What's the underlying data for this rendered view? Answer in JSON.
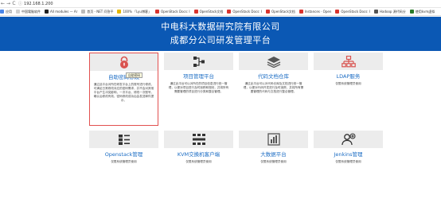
{
  "browser": {
    "url": "192.168.1.200",
    "nav": {
      "back": "←",
      "forward": "→",
      "reload": "C"
    },
    "bookmarks": [
      {
        "label": "应用",
        "color": "#4a86e8"
      },
      {
        "label": "中国電脑软件",
        "color": "#d0d0d0"
      },
      {
        "label": "All modules — Ar",
        "color": "#222222"
      },
      {
        "label": "首页 - NET 问答平",
        "color": "#bbbbbb"
      },
      {
        "label": "100% 「Lyu博客」",
        "color": "#e5b700"
      },
      {
        "label": "OpenStack Docs: I",
        "color": "#d9352f"
      },
      {
        "label": "OpenStack文档",
        "color": "#d9352f"
      },
      {
        "label": "OpenStack Docs: I",
        "color": "#d9352f"
      },
      {
        "label": "OpenStack文档",
        "color": "#d9352f"
      },
      {
        "label": "Instances · Open",
        "color": "#d9352f"
      },
      {
        "label": "OpenStack Docs: I",
        "color": "#d9352f"
      },
      {
        "label": "Hadoop 源代码分",
        "color": "#555555"
      },
      {
        "label": "使用kvm虚拟",
        "color": "#2a7a2a"
      }
    ]
  },
  "header": {
    "title_line1": "中电科大数据研究院有限公司",
    "title_line2": "成都分公司研发管理平台"
  },
  "cards": [
    {
      "title": "自助密码修改",
      "icon": "lock-icon",
      "icon_color": "#d9534f",
      "desc": "通过此平台对所在研发平台上的账号进行修改，可满足日常修改对应的密码需求，并不会对其他平台产生冲突影响，一次平台，修改一次账号，确认后修改有效，密码修改成功后会发送邮件提示。",
      "selected": true,
      "tooltip": "自助密码"
    },
    {
      "title": "项目管理平台",
      "icon": "sitemap-icon",
      "icon_color": "#333333",
      "desc": "通过此平台可以对所在的项目信息进行统一管理，以便对项目进行及时追踪和规划，并将所有需要管理的项目进行分类和整合管理。"
    },
    {
      "title": "代码文档仓库",
      "icon": "layers-icon",
      "icon_color": "#555555",
      "desc": "通过此平台可以对代码仓库及文档进行统一管理，以便对代码开发进行及时追踪，并将所有需要管理的代码与文档进行整合管理。"
    },
    {
      "title": "LDAP服务",
      "icon": "hierarchy-icon",
      "icon_color": "#d9534f",
      "desc": "仅限系统管理员使用"
    },
    {
      "title": "Openstack管理",
      "icon": "server-list-icon",
      "icon_color": "#333333",
      "desc": "仅限系统管理员使用"
    },
    {
      "title": "KVM交换机客户端",
      "icon": "network-grid-icon",
      "icon_color": "#333333",
      "desc": "仅限系统管理员使用"
    },
    {
      "title": "大数据平台",
      "icon": "data-icon",
      "icon_color": "#555555",
      "desc": "仅限系统管理员使用"
    },
    {
      "title": "Jenkins管理",
      "icon": "user-add-icon",
      "icon_color": "#333333",
      "desc": "仅限系统管理员使用"
    }
  ]
}
